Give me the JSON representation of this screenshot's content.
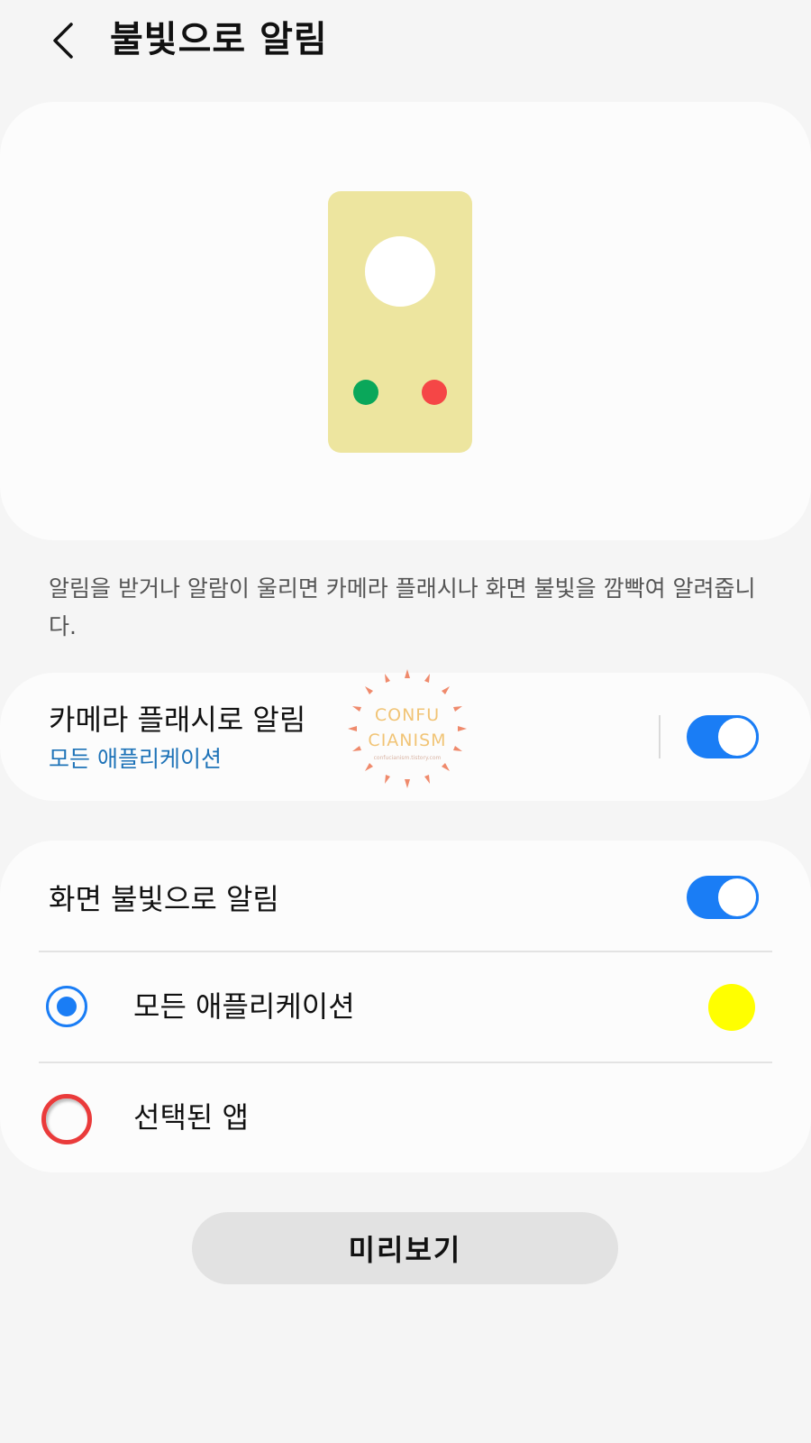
{
  "header": {
    "back_icon": "chevron-left-icon",
    "title": "불빛으로 알림"
  },
  "illustration": {
    "phone_color": "#ede59f",
    "dot_colors": [
      "#0aa75a",
      "#f54646"
    ]
  },
  "description": "알림을 받거나 알람이 울리면 카메라 플래시나 화면 불빛을 깜빡여 알려줍니다.",
  "camera_flash": {
    "title": "카메라 플래시로 알림",
    "subtitle": "모든 애플리케이션",
    "toggle_on": true
  },
  "watermark": {
    "line1": "CONFU",
    "line2": "CIANISM",
    "line3": "confucianism.tistory.com"
  },
  "screen_flash": {
    "title": "화면 불빛으로 알림",
    "toggle_on": true,
    "options": [
      {
        "label": "모든 애플리케이션",
        "selected": true,
        "color": "#ffff00"
      },
      {
        "label": "선택된 앱",
        "selected": false
      }
    ]
  },
  "preview_button": {
    "label": "미리보기"
  },
  "colors": {
    "accent": "#1a7df5",
    "link": "#1e73b8",
    "highlight_circle": "#ea3b3b"
  }
}
